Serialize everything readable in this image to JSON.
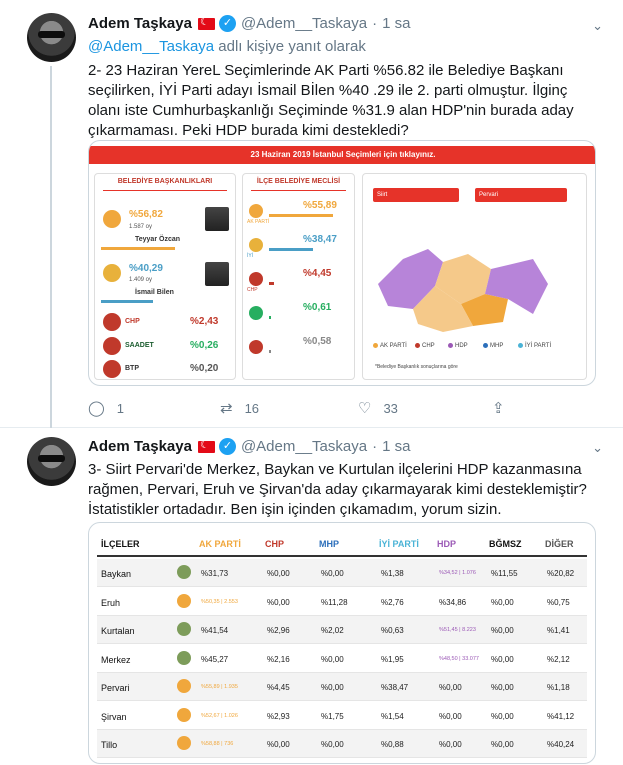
{
  "tweet1": {
    "name": "Adem Taşkaya",
    "handle": "@Adem__Taskaya",
    "separator": "·",
    "time": "1 sa",
    "reply_prefix": "@Adem__Taskaya",
    "reply_suffix": " adlı kişiye yanıt olarak",
    "text": "2- 23 Haziran YereL Seçimlerinde AK Parti %56.82 ile Belediye Başkanı seçilirken, İYİ Parti adayı İsmail Bİlen %40 .29 ile 2. parti olmuştur. İlginç olanı iste Cumhurbaşkanlığı Seçiminde %31.9 alan HDP'nin burada aday çıkarmaması. Peki HDP burada kimi destekledi?",
    "card": {
      "banner": "23 Haziran 2019 İstanbul Seçimleri için tıklayınız.",
      "panel1": {
        "title": "BELEDİYE BAŞKANLIKLARI",
        "cand1": {
          "pct": "%56,82",
          "votes": "1.587 oy",
          "name": "Teyyar Özcan",
          "bar": 0.5682
        },
        "cand2": {
          "pct": "%40,29",
          "votes": "1.409 oy",
          "name": "İsmail Bilen",
          "bar": 0.4029
        },
        "others": [
          {
            "party": "CHP",
            "pct": "%2,43"
          },
          {
            "party": "SAADET",
            "pct": "%0,26"
          },
          {
            "party": "BTP",
            "pct": "%0,20"
          }
        ]
      },
      "panel2": {
        "title": "İLÇE BELEDİYE MECLİSİ",
        "rows": [
          {
            "pct": "%55,89",
            "bar": 0.5589,
            "color": "#f0a73c",
            "label": "AK PARTİ"
          },
          {
            "pct": "%38,47",
            "bar": 0.3847,
            "color": "#4a9ec6",
            "label": "İYİ"
          },
          {
            "pct": "%4,45",
            "bar": 0.0445,
            "color": "#c0392b",
            "label": "CHP"
          },
          {
            "pct": "%0,61",
            "bar": 0.0061,
            "color": "#27ae60",
            "label": ""
          },
          {
            "pct": "%0,58",
            "bar": 0.0058,
            "color": "#888888",
            "label": ""
          }
        ]
      },
      "panel3": {
        "select1": "Siirt",
        "select2": "Pervari",
        "legend": [
          {
            "label": "AK PARTİ",
            "color": "#f0a73c"
          },
          {
            "label": "CHP",
            "color": "#c0392b"
          },
          {
            "label": "HDP",
            "color": "#9b59b6"
          },
          {
            "label": "MHP",
            "color": "#2c6fbb"
          },
          {
            "label": "İYİ PARTİ",
            "color": "#4ab3d6"
          }
        ],
        "footnote": "*Belediye Başkanlık sonuçlarına göre"
      }
    },
    "actions": {
      "replies": "1",
      "retweets": "16",
      "likes": "33"
    }
  },
  "tweet2": {
    "name": "Adem Taşkaya",
    "handle": "@Adem__Taskaya",
    "separator": "·",
    "time": "1 sa",
    "text": "3- Siirt Pervari'de Merkez, Baykan ve Kurtulan ilçelerini HDP kazanmasına rağmen, Pervari, Eruh ve Şirvan'da aday çıkarmayarak kimi desteklemiştir? İstatistikler ortadadır. Ben işin içinden çıkamadım, yorum sizin.",
    "table": {
      "headers": [
        {
          "label": "İLÇELER",
          "color": "#111111"
        },
        {
          "label": "AK PARTİ",
          "color": "#f0a73c"
        },
        {
          "label": "CHP",
          "color": "#c0392b"
        },
        {
          "label": "MHP",
          "color": "#2c6fbb"
        },
        {
          "label": "İYİ PARTİ",
          "color": "#4ab3d6"
        },
        {
          "label": "HDP",
          "color": "#9b59b6"
        },
        {
          "label": "BĞMSZ",
          "color": "#111111"
        },
        {
          "label": "DİĞER",
          "color": "#555555"
        }
      ],
      "rows": [
        {
          "name": "Baykan",
          "icon": "hdp",
          "cells": [
            "%31,73",
            "%0,00",
            "%0,00",
            "%1,38",
            "%34,52 | 1.076",
            "%11,55",
            "%20,82"
          ],
          "hl": 4
        },
        {
          "name": "Eruh",
          "icon": "akp",
          "cells": [
            "%50,35 | 2.553",
            "%0,00",
            "%11,28",
            "%2,76",
            "%34,86",
            "%0,00",
            "%0,75"
          ],
          "hl": 0
        },
        {
          "name": "Kurtalan",
          "icon": "hdp",
          "cells": [
            "%41,54",
            "%2,96",
            "%2,02",
            "%0,63",
            "%51,45 | 8.223",
            "%0,00",
            "%1,41"
          ],
          "hl": 4
        },
        {
          "name": "Merkez",
          "icon": "hdp",
          "cells": [
            "%45,27",
            "%2,16",
            "%0,00",
            "%1,95",
            "%48,50 | 33.077",
            "%0,00",
            "%2,12"
          ],
          "hl": 4
        },
        {
          "name": "Pervari",
          "icon": "akp",
          "cells": [
            "%55,89 | 1.935",
            "%4,45",
            "%0,00",
            "%38,47",
            "%0,00",
            "%0,00",
            "%1,18"
          ],
          "hl": 0
        },
        {
          "name": "Şirvan",
          "icon": "akp",
          "cells": [
            "%52,67 | 1.026",
            "%2,93",
            "%1,75",
            "%1,54",
            "%0,00",
            "%0,00",
            "%41,12"
          ],
          "hl": 0
        },
        {
          "name": "Tillo",
          "icon": "akp",
          "cells": [
            "%58,88 | 736",
            "%0,00",
            "%0,00",
            "%0,88",
            "%0,00",
            "%0,00",
            "%40,24"
          ],
          "hl": 0
        }
      ]
    }
  }
}
